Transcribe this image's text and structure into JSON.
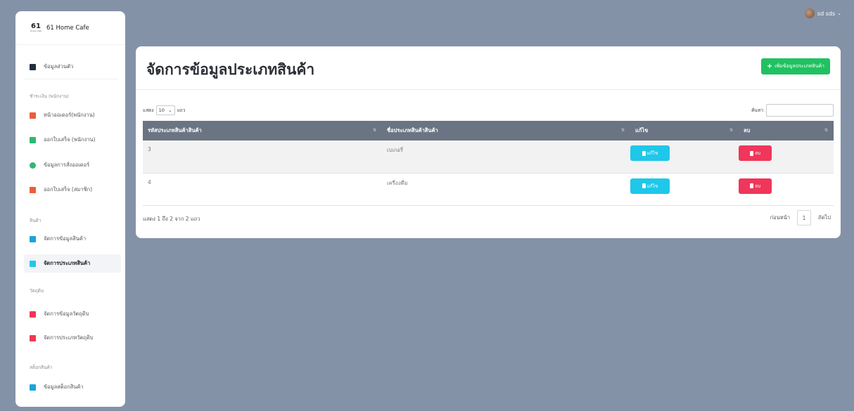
{
  "brand": {
    "logo_text": "61",
    "logo_sub": "Home cafe",
    "name": "61 Home Cafe"
  },
  "sidebar": {
    "items": [
      {
        "label": "ข้อมูลส่วนตัว",
        "icon": "id-card-icon",
        "color": "#1f2d3d"
      },
      {
        "label": "หน้าออเดอร์(พนักงาน)",
        "icon": "book-icon",
        "color": "#ef5b3a"
      },
      {
        "label": "ออกใบเสร็จ (พนักงาน)",
        "icon": "book-icon",
        "color": "#2eb872"
      },
      {
        "label": "ข้อมูลการสั่งออเดอร์",
        "icon": "users-icon",
        "color": "#2eb872"
      },
      {
        "label": "ออกใบเสร็จ (สมาชิก)",
        "icon": "book-icon",
        "color": "#ef5b3a"
      },
      {
        "label": "จัดการข้อมูลสินค้า",
        "icon": "boxes-icon",
        "color": "#1ca3d8"
      },
      {
        "label": "จัดการประเภทสินค้า",
        "icon": "book-icon",
        "color": "#1fc7ea"
      },
      {
        "label": "จัดการข้อมูลวัตถุดิบ",
        "icon": "briefcase-icon",
        "color": "#f0365a"
      },
      {
        "label": "จัดการประเภทวัตถุดิบ",
        "icon": "book-icon",
        "color": "#ef3a4f"
      },
      {
        "label": "ข้อมูลสต็อกสินค้า",
        "icon": "boxes-icon",
        "color": "#1ca3d8"
      }
    ],
    "sections": [
      "ชำระเงิน (พนักงาน)",
      "สินค้า",
      "วัตถุดิบ",
      "สต็อกสินค้า"
    ]
  },
  "user": {
    "name": "sd sds"
  },
  "main": {
    "title": "จัดการข้อมูลประเภทสินค้า",
    "add_button": "เพิ่มข้อมูลประเภทสินค้า",
    "length": {
      "prefix": "แสดง",
      "value": "10",
      "suffix": "แถว"
    },
    "search_label": "ค้นหา:",
    "columns": [
      "รหัสประเภทสินค้าสินค้า",
      "ชื่อประเภทสินค้าสินค้า",
      "แก้ไข",
      "ลบ"
    ],
    "rows": [
      {
        "id": "3",
        "name": "เบเกอรี่"
      },
      {
        "id": "4",
        "name": "เครื่องดื่ม"
      }
    ],
    "edit_label": "แก้ไข",
    "delete_label": "ลบ",
    "info": "แสดง 1 ถึง 2 จาก 2 แถว",
    "pager": {
      "prev": "ก่อนหน้า",
      "page": "1",
      "next": "ถัดไป"
    }
  }
}
